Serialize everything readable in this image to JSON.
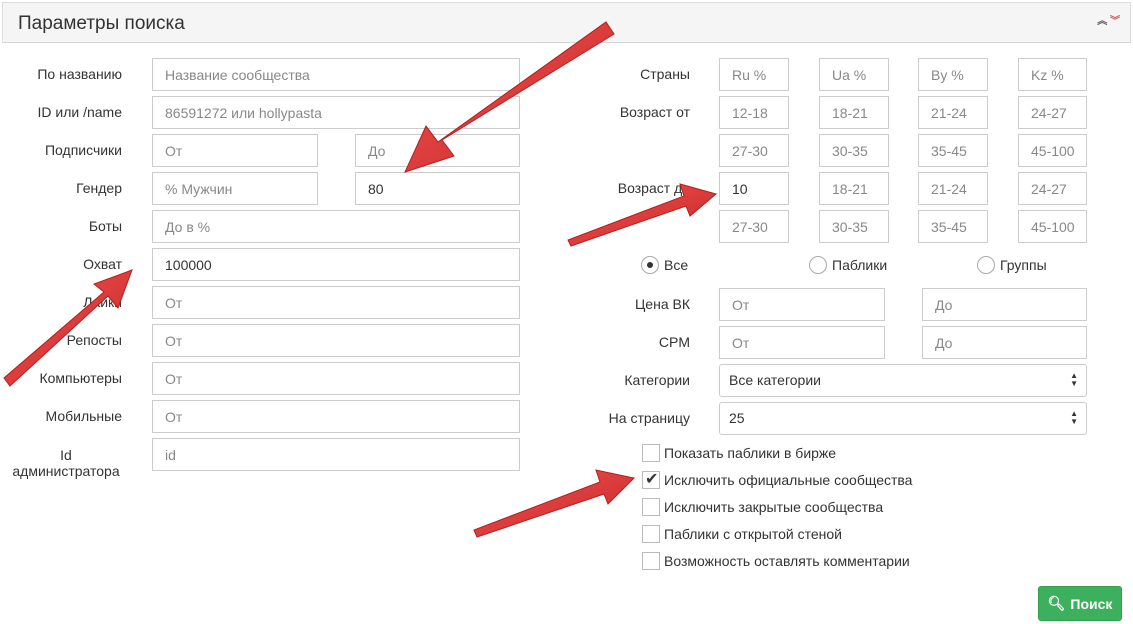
{
  "header": {
    "title": "Параметры поиска",
    "collapse_up": "«",
    "collapse_down": "»"
  },
  "left": {
    "name_label": "По названию",
    "name_placeholder": "Название сообщества",
    "id_label": "ID или /name",
    "id_placeholder": "86591272 или hollypasta",
    "subs_label": "Подписчики",
    "subs_from_placeholder": "От",
    "subs_to_placeholder": "До",
    "gender_label": "Гендер",
    "gender_placeholder": "% Мужчин",
    "gender_value": "80",
    "bots_label": "Боты",
    "bots_placeholder": "До в %",
    "reach_label": "Охват",
    "reach_value": "100000",
    "likes_label": "Лайки",
    "likes_placeholder": "От",
    "reposts_label": "Репосты",
    "reposts_placeholder": "От",
    "computers_label": "Компьютеры",
    "computers_placeholder": "От",
    "mobile_label": "Мобильные",
    "mobile_placeholder": "От",
    "admin_label_line1": "Id",
    "admin_label_line2": "администратора",
    "admin_placeholder": "id"
  },
  "right": {
    "countries_label": "Страны",
    "countries": [
      "Ru %",
      "Ua %",
      "By %",
      "Kz %"
    ],
    "age_from_label": "Возраст от",
    "age_from_row1": [
      "12-18",
      "18-21",
      "21-24",
      "24-27"
    ],
    "age_from_row2": [
      "27-30",
      "30-35",
      "35-45",
      "45-100"
    ],
    "age_to_label": "Возраст до",
    "age_to_value": "10",
    "age_to_row1_rest": [
      "18-21",
      "21-24",
      "24-27"
    ],
    "age_to_row2": [
      "27-30",
      "30-35",
      "35-45",
      "45-100"
    ],
    "radio_all": "Все",
    "radio_publics": "Паблики",
    "radio_groups": "Группы",
    "price_label": "Цена ВК",
    "price_from": "От",
    "price_to": "До",
    "cpm_label": "CPM",
    "cpm_from": "От",
    "cpm_to": "До",
    "categories_label": "Категории",
    "categories_value": "Все категории",
    "per_page_label": "На страницу",
    "per_page_value": "25",
    "checkboxes": [
      "Показать паблики в бирже",
      "Исключить официальные сообщества",
      "Исключить закрытые сообщества",
      "Паблики с открытой стеной",
      "Возможность оставлять комментарии"
    ],
    "search_button": "Поиск"
  },
  "colors": {
    "arrow": "#e53935",
    "button": "#3cb05c"
  }
}
